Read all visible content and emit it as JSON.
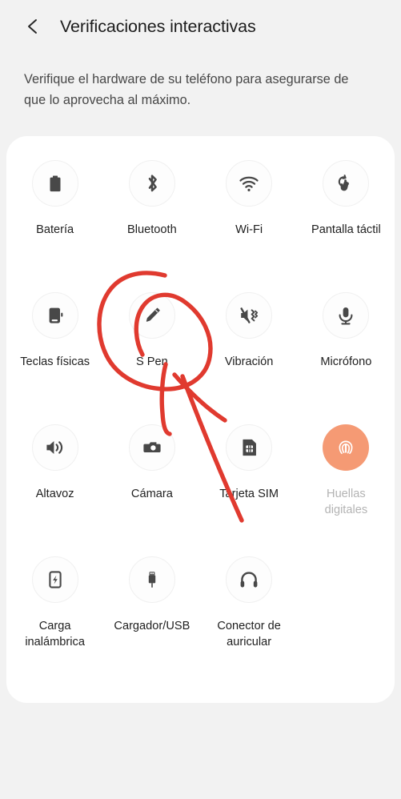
{
  "header": {
    "back_icon": "chevron-left-icon",
    "title": "Verificaciones interactivas"
  },
  "subtitle": "Verifique el hardware de su teléfono para asegurarse de que lo aprovecha al máximo.",
  "colors": {
    "page_background": "#f2f2f2",
    "card_background": "#ffffff",
    "icon_dark": "#484848",
    "label_text": "#1f1f1f",
    "label_dim": "#b3b3b3",
    "active_tile": "#f59a74",
    "annotation_red": "#e03a2f"
  },
  "tiles": [
    {
      "label": "Batería",
      "icon": "battery-icon",
      "active": false
    },
    {
      "label": "Bluetooth",
      "icon": "bluetooth-icon",
      "active": false
    },
    {
      "label": "Wi-Fi",
      "icon": "wifi-icon",
      "active": false
    },
    {
      "label": "Pantalla táctil",
      "icon": "touchscreen-tap-icon",
      "active": false
    },
    {
      "label": "Teclas físicas",
      "icon": "phone-hardkeys-icon",
      "active": false
    },
    {
      "label": "S Pen",
      "icon": "pen-icon",
      "active": false
    },
    {
      "label": "Vibración",
      "icon": "vibration-mute-icon",
      "active": false
    },
    {
      "label": "Micrófono",
      "icon": "microphone-icon",
      "active": false
    },
    {
      "label": "Altavoz",
      "icon": "speaker-icon",
      "active": false
    },
    {
      "label": "Cámara",
      "icon": "camera-icon",
      "active": false
    },
    {
      "label": "Tarjeta SIM",
      "icon": "sim-card-icon",
      "active": false
    },
    {
      "label": "Huellas\ndigitales",
      "icon": "fingerprint-icon",
      "active": true
    },
    {
      "label": "Carga\ninalámbrica",
      "icon": "wireless-charging-icon",
      "active": false
    },
    {
      "label": "Cargador/USB",
      "icon": "usb-connector-icon",
      "active": false
    },
    {
      "label": "Conector de\nauricular",
      "icon": "headphone-jack-icon",
      "active": false
    }
  ],
  "annotation": {
    "type": "handwritten-red-marker",
    "description": "Red circle drawn around the S Pen tile with an arrow stroke pointing down-right"
  }
}
